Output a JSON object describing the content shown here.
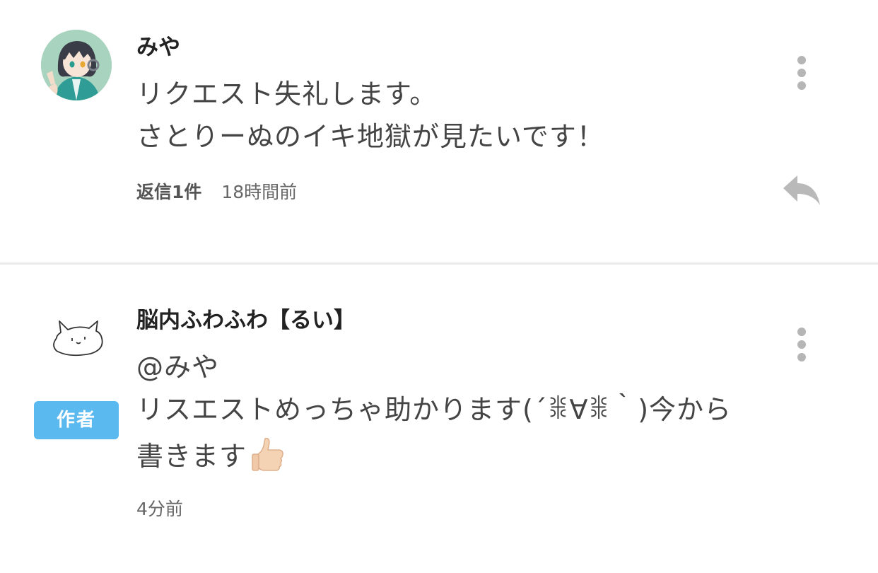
{
  "comments": [
    {
      "username": "みや",
      "lines": [
        "リクエスト失礼します。",
        "さとりーぬのイキ地獄が見たいです！"
      ],
      "reply_count": "返信1件",
      "time": "18時間前",
      "avatar_icon": "anime-avatar-icon",
      "more_icon": "more-vertical-icon",
      "reply_icon": "reply-arrow-icon"
    },
    {
      "username": "脳内ふわふわ【るい】",
      "lines": [
        "@みや",
        "リスエストめっちゃ助かります(´ꒌ∀ꒌ｀)今から",
        "書きます"
      ],
      "emoji_icon": "thumbs-up-icon",
      "badge": "作者",
      "time": "4分前",
      "avatar_icon": "cat-doodle-avatar-icon",
      "more_icon": "more-vertical-icon"
    }
  ],
  "colors": {
    "badge": "#5ab9ef",
    "divider": "#ebebeb",
    "icon_gray": "#b5b5b5"
  }
}
